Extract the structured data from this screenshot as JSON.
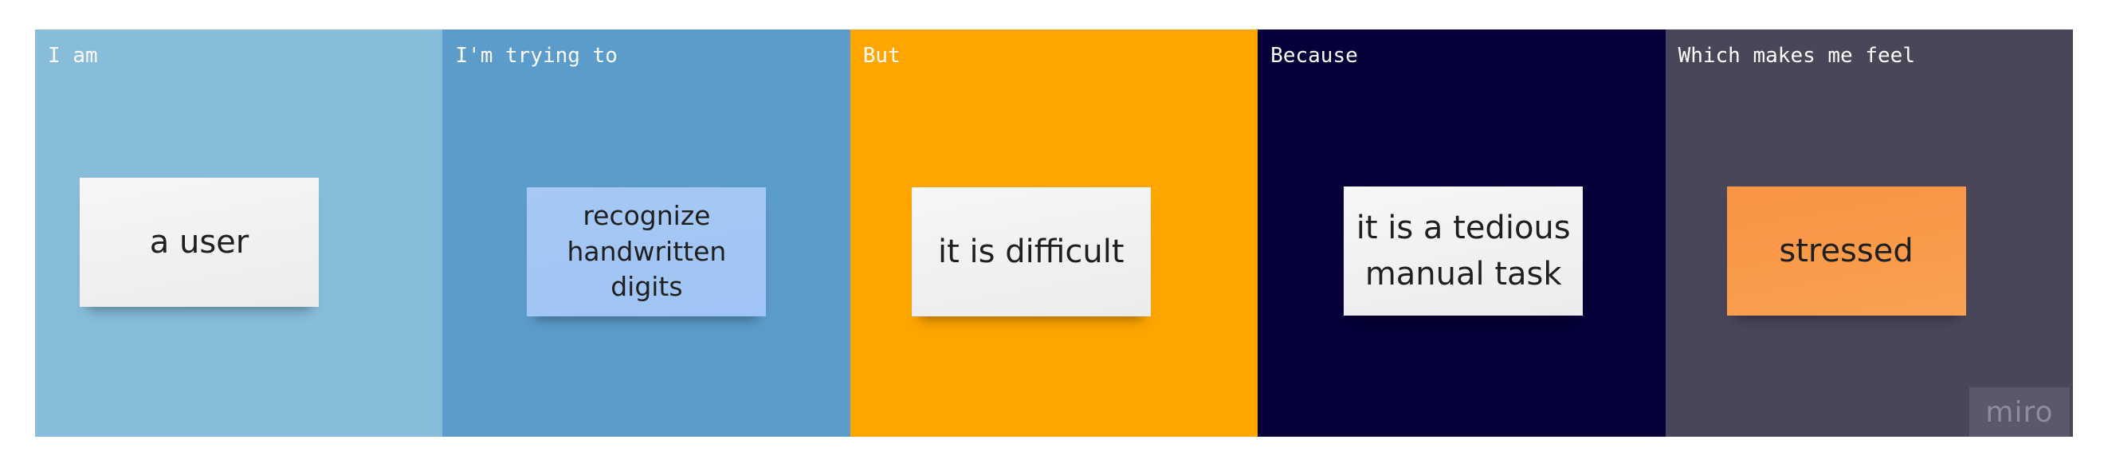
{
  "colors": {
    "col1": "#87bddb",
    "col2": "#5c9ccb",
    "col3": "#fea500",
    "col4": "#050038",
    "col5": "#4a4659"
  },
  "columns": [
    {
      "label": "I am",
      "sticky": "a user"
    },
    {
      "label": "I'm trying to",
      "sticky": "recognize handwritten digits"
    },
    {
      "label": "But",
      "sticky": "it is difficult"
    },
    {
      "label": "Because",
      "sticky": "it is a tedious manual task"
    },
    {
      "label": "Which makes me feel",
      "sticky": "stressed"
    }
  ],
  "watermark": "miro"
}
